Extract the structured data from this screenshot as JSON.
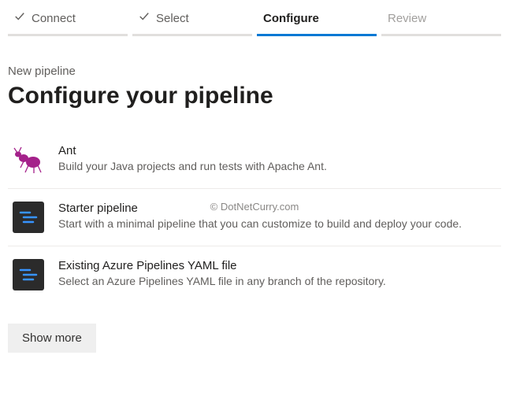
{
  "steps": [
    {
      "label": "Connect",
      "state": "done"
    },
    {
      "label": "Select",
      "state": "done"
    },
    {
      "label": "Configure",
      "state": "active"
    },
    {
      "label": "Review",
      "state": "upcoming"
    }
  ],
  "breadcrumb": "New pipeline",
  "page_title": "Configure your pipeline",
  "templates": [
    {
      "icon": "ant-icon",
      "title": "Ant",
      "description": "Build your Java projects and run tests with Apache Ant."
    },
    {
      "icon": "yaml-icon",
      "title": "Starter pipeline",
      "description": "Start with a minimal pipeline that you can customize to build and deploy your code."
    },
    {
      "icon": "yaml-icon",
      "title": "Existing Azure Pipelines YAML file",
      "description": "Select an Azure Pipelines YAML file in any branch of the repository."
    }
  ],
  "show_more_label": "Show more",
  "watermark": "© DotNetCurry.com"
}
